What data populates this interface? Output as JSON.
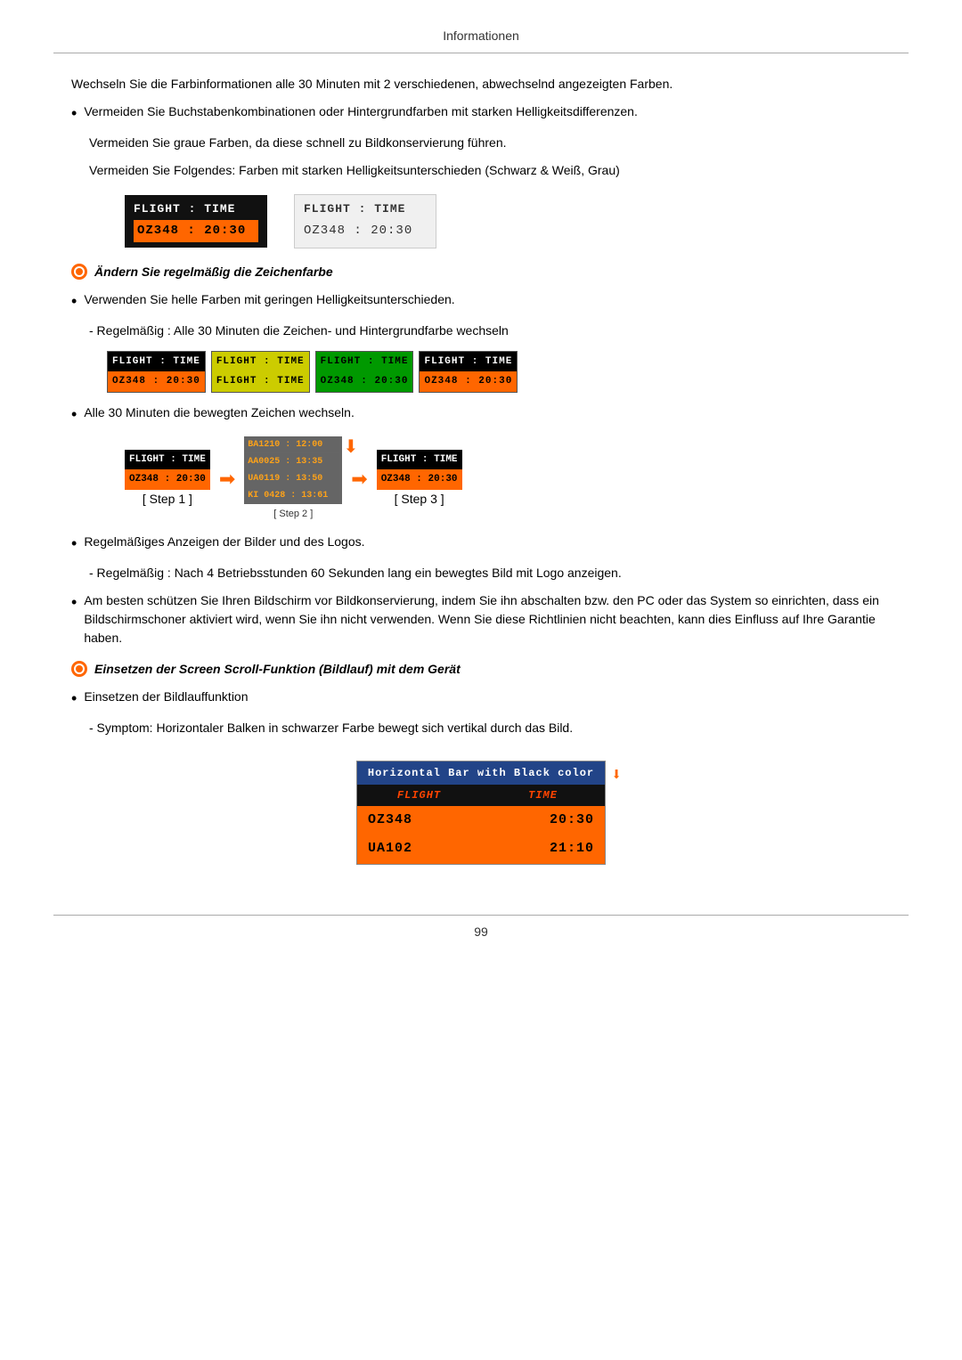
{
  "header": {
    "title": "Informationen"
  },
  "footer": {
    "page_number": "99"
  },
  "content": {
    "intro_paragraph": "Wechseln Sie die Farbinformationen alle 30 Minuten mit 2 verschiedenen, abwechselnd angezeigten Farben.",
    "bullet1": {
      "text": "Vermeiden Sie Buchstabenkombinationen oder Hintergrundfarben mit starken Helligkeitsdifferenzen."
    },
    "sub_note1": "Vermeiden Sie graue Farben, da diese schnell zu Bildkonservierung führen.",
    "sub_note2": "Vermeiden Sie Folgendes: Farben mit starken Helligkeitsunterschieden (Schwarz & Weiß, Grau)",
    "demo_box1_header": "FLIGHT  :  TIME",
    "demo_box1_data": "OZ348   :  20:30",
    "demo_box2_header": "FLIGHT  :  TIME",
    "demo_box2_data": "OZ348   :  20:30",
    "section1_heading": "Ändern Sie regelmäßig die Zeichenfarbe",
    "bullet2": {
      "text": "Verwenden Sie helle Farben mit geringen Helligkeitsunterschieden."
    },
    "sub_note3": "- Regelmäßig : Alle 30 Minuten die Zeichen- und Hintergrundfarbe wechseln",
    "color_boxes": [
      {
        "header": "FLIGHT : TIME",
        "data": "OZ348  : 20:30",
        "variant": "v1"
      },
      {
        "header": "FLIGHT : TIME",
        "data": "FLIGHT : TIME",
        "variant": "v2"
      },
      {
        "header": "FLIGHT : TIME",
        "data": "OZ348  : 20:30",
        "variant": "v3"
      },
      {
        "header": "FLIGHT : TIME",
        "data": "OZ348  : 20:30",
        "variant": "v4"
      }
    ],
    "bullet3": {
      "text": "Alle 30 Minuten die bewegten Zeichen wechseln."
    },
    "step1_header": "FLIGHT : TIME",
    "step1_data": "OZ348  : 20:30",
    "step1_label": "[ Step 1 ]",
    "step2_header": "BA1210 : 12:00",
    "step2_data2": "AA0025 : 13:35",
    "step2_data3": "UA0119 : 13:50",
    "step2_data4": "KI 0428 : 13:61",
    "step2_label": "[ Step 2 ]",
    "step3_header": "FLIGHT : TIME",
    "step3_data": "OZ348  : 20:30",
    "step3_label": "[ Step 3 ]",
    "bullet4": {
      "text": "Regelmäßiges Anzeigen der Bilder und des Logos."
    },
    "sub_note4": "- Regelmäßig : Nach 4 Betriebsstunden 60 Sekunden lang ein bewegtes Bild mit Logo anzeigen.",
    "bullet5": {
      "text": "Am besten schützen Sie Ihren Bildschirm vor Bildkonservierung, indem Sie ihn abschalten bzw. den PC oder das System so einrichten, dass ein Bildschirmschoner aktiviert wird, wenn Sie ihn nicht verwenden. Wenn Sie diese Richtlinien nicht beachten, kann dies Einfluss auf Ihre Garantie haben."
    },
    "section2_heading": "Einsetzen der Screen Scroll-Funktion (Bildlauf) mit dem Gerät",
    "bullet6": {
      "text": "Einsetzen der Bildlauffunktion"
    },
    "sub_note5": "- Symptom: Horizontaler Balken in schwarzer Farbe bewegt sich vertikal durch das Bild.",
    "final_box_header": "Horizontal Bar with Black color",
    "final_row1_flight": "FLIGHT",
    "final_row1_time": "TIME",
    "final_row2_flight": "OZ348",
    "final_row2_time": "20:30",
    "final_row3_flight": "UA102",
    "final_row3_time": "21:10"
  }
}
